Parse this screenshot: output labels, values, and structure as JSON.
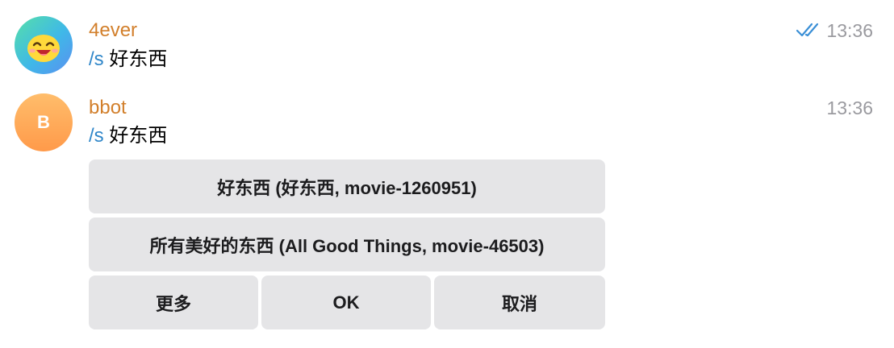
{
  "messages": [
    {
      "sender": "4ever",
      "avatar": "smiling-emoji-avatar",
      "command": "/s",
      "text": "好东西",
      "time": "13:36",
      "status": "read-double-check"
    },
    {
      "sender": "bbot",
      "avatar_initial": "B",
      "command": "/s",
      "text": "好东西",
      "time": "13:36"
    }
  ],
  "keyboard": {
    "row1": "好东西 (好东西, movie-1260951)",
    "row2": "所有美好的东西 (All Good Things, movie-46503)",
    "row3": [
      "更多",
      "OK",
      "取消"
    ]
  },
  "colors": {
    "sender": "#d27f2b",
    "command": "#2f86c9",
    "time": "#9a9a9f",
    "check": "#3a8fd6",
    "button_bg": "#e5e5e7"
  }
}
